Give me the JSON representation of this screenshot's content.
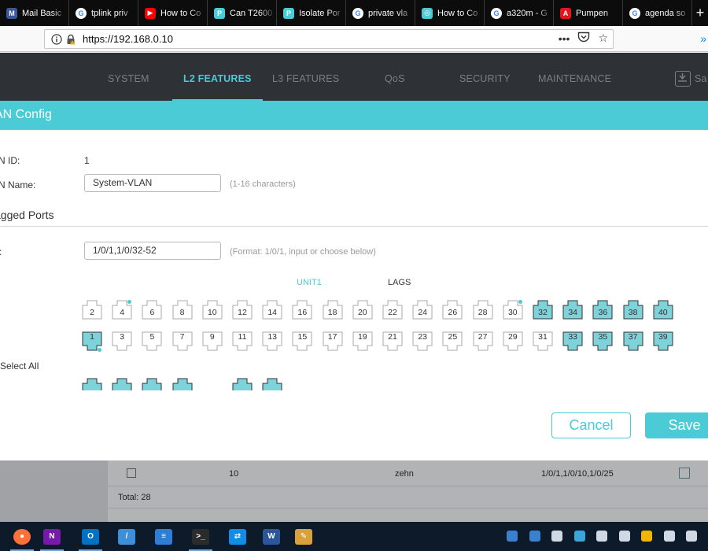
{
  "browser": {
    "tabs": [
      {
        "label": "Mail Basic",
        "icon": "mail-icon",
        "color": "#3b5998",
        "glyph": "M"
      },
      {
        "label": "tplink priv",
        "icon": "google-icon",
        "color": "#ffffff",
        "glyph": "G"
      },
      {
        "label": "How to Co",
        "icon": "youtube-icon",
        "color": "#ff0000",
        "glyph": "▶"
      },
      {
        "label": "Can T2600",
        "icon": "tplink-icon",
        "color": "#4acbd6",
        "glyph": "P"
      },
      {
        "label": "Isolate Por",
        "icon": "tplink-icon",
        "color": "#4acbd6",
        "glyph": "P"
      },
      {
        "label": "private vla",
        "icon": "google-icon",
        "color": "#ffffff",
        "glyph": "G"
      },
      {
        "label": "How to Co",
        "icon": "tplink-icon",
        "color": "#4acbd6",
        "glyph": "◎"
      },
      {
        "label": "a320m - G",
        "icon": "google-icon",
        "color": "#ffffff",
        "glyph": "G"
      },
      {
        "label": "Pumpen",
        "icon": "adobe-icon",
        "color": "#e0171f",
        "glyph": "A"
      },
      {
        "label": "agenda so",
        "icon": "google-icon",
        "color": "#ffffff",
        "glyph": "G"
      }
    ],
    "new_tab": "+",
    "url": "https://192.168.0.10",
    "page_actions": "•••"
  },
  "app_menu": {
    "items": [
      "SYSTEM",
      "L2 FEATURES",
      "L3 FEATURES",
      "QoS",
      "SECURITY",
      "MAINTENANCE"
    ],
    "active": "L2 FEATURES",
    "save_label": "Sa"
  },
  "dialog": {
    "title": "AN Config",
    "vlan_id_label": "N ID:",
    "vlan_id_value": "1",
    "vlan_name_label": "N Name:",
    "vlan_name_value": "System-VLAN",
    "vlan_name_hint": "(1-16 characters)",
    "section_title": "agged Ports",
    "ports_label": ":",
    "ports_value": "1/0/1,1/0/32-52",
    "ports_hint": "(Format: 1/0/1, input or choose below)",
    "unit_tab": "UNIT1",
    "lags_tab": "LAGS",
    "select_all": "Select All",
    "top_row_ports": [
      "2",
      "4",
      "6",
      "8",
      "10",
      "12",
      "14",
      "16",
      "18",
      "20",
      "22",
      "24",
      "26",
      "28",
      "30",
      "32",
      "34",
      "36",
      "38",
      "40"
    ],
    "bottom_row_ports": [
      "1",
      "3",
      "5",
      "7",
      "9",
      "11",
      "13",
      "15",
      "17",
      "19",
      "21",
      "23",
      "25",
      "27",
      "29",
      "31",
      "33",
      "35",
      "37",
      "39"
    ],
    "selected_ports": [
      "1",
      "32",
      "33",
      "34",
      "35",
      "36",
      "37",
      "38",
      "39",
      "40"
    ],
    "linkup_ports": [
      "1",
      "4",
      "30"
    ],
    "cancel_label": "Cancel",
    "save_label": "Save"
  },
  "background_table": {
    "row": {
      "vlan_id": "10",
      "name": "zehn",
      "members": "1/0/1,1/0/10,1/0/25"
    },
    "total": "Total: 28"
  },
  "taskbar": {
    "apps": [
      {
        "name": "firefox-icon",
        "color": "#ff7139",
        "glyph": "●"
      },
      {
        "name": "onenote-icon",
        "color": "#7719aa",
        "glyph": "N"
      },
      {
        "name": "outlook-icon",
        "color": "#0072c6",
        "glyph": "O"
      },
      {
        "name": "notepad-icon",
        "color": "#3d8fd9",
        "glyph": "/"
      },
      {
        "name": "network-icon",
        "color": "#2d7fd6",
        "glyph": "≡"
      },
      {
        "name": "terminal-icon",
        "color": "#2b2b2b",
        "glyph": ">_"
      },
      {
        "name": "teamviewer-icon",
        "color": "#0e8ee9",
        "glyph": "⇄"
      },
      {
        "name": "word-icon",
        "color": "#2b579a",
        "glyph": "W"
      },
      {
        "name": "paint-icon",
        "color": "#d9a13b",
        "glyph": "✎"
      }
    ]
  }
}
